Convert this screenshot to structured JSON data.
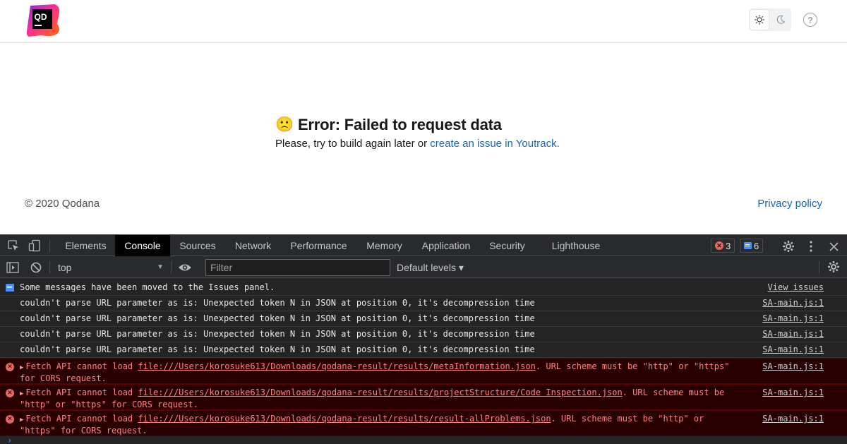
{
  "app": {
    "logo_text": "QD",
    "brand_colors": [
      "#ff318c",
      "#ff6b00",
      "#8a2be2",
      "#000000"
    ]
  },
  "header": {
    "theme_light_icon": "sun-icon",
    "theme_dark_icon": "moon-icon",
    "help_label": "?"
  },
  "error": {
    "emoji": "🙁",
    "title": "Error: Failed to request data",
    "text_prefix": "Please, try to build again later or ",
    "link_text": "create an issue in Youtrack."
  },
  "footer": {
    "copyright": "© 2020 Qodana",
    "privacy": "Privacy policy"
  },
  "devtools": {
    "tabs": [
      "Elements",
      "Console",
      "Sources",
      "Network",
      "Performance",
      "Memory",
      "Application",
      "Security",
      "Lighthouse"
    ],
    "active_tab": "Console",
    "error_count": "3",
    "message_count": "6",
    "context": "top",
    "filter_placeholder": "Filter",
    "levels": "Default levels ▾",
    "messages": {
      "info_text": "Some messages have been moved to the Issues panel.",
      "info_link": "View issues",
      "log_text": "couldn't parse URL parameter as is: Unexpected token N in JSON at position 0, it's decompression time",
      "log_source": "SA-main.js:1",
      "errors": [
        {
          "prefix": "Fetch API cannot load ",
          "file": "file:///Users/korosuke613/Downloads/qodana-result/results/metaInformation.json",
          "suffix": ". URL scheme must be \"http\" or \"https\" for CORS request.",
          "source": "SA-main.js:1"
        },
        {
          "prefix": "Fetch API cannot load ",
          "file": "file:///Users/korosuke613/Downloads/qodana-result/results/projectStructure/Code Inspection.json",
          "suffix": ". URL scheme must be \"http\" or \"https\" for CORS request.",
          "source": "SA-main.js:1"
        },
        {
          "prefix": "Fetch API cannot load ",
          "file": "file:///Users/korosuke613/Downloads/qodana-result/results/result-allProblems.json",
          "suffix": ". URL scheme must be \"http\" or \"https\" for CORS request.",
          "source": "SA-main.js:1"
        }
      ]
    }
  }
}
